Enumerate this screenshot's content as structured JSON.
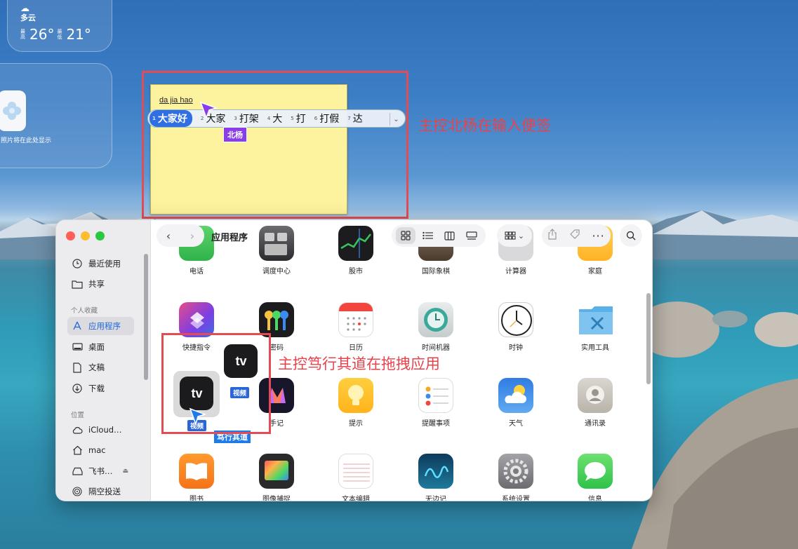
{
  "weather": {
    "condition": "多云",
    "high_label": "最高",
    "high": "26°",
    "low_label": "最低",
    "low": "21°"
  },
  "photo_widget": {
    "text": "照片将在此处显示"
  },
  "sticky": {
    "text": "da jia hao"
  },
  "ime": {
    "candidates": [
      {
        "n": "1",
        "text": "大家好"
      },
      {
        "n": "2",
        "text": "大家"
      },
      {
        "n": "3",
        "text": "打架"
      },
      {
        "n": "4",
        "text": "大"
      },
      {
        "n": "5",
        "text": "打"
      },
      {
        "n": "6",
        "text": "打假"
      },
      {
        "n": "7",
        "text": "达"
      }
    ]
  },
  "cursors": {
    "beiyang": "北杨",
    "duxing": "笃行其道"
  },
  "annotations": {
    "sticky_label": "主控北杨在输入便签",
    "drag_label": "主控笃行其道在拖拽应用"
  },
  "finder": {
    "title": "应用程序",
    "sidebar": {
      "recent": "最近使用",
      "shared": "共享",
      "favorites_header": "个人收藏",
      "applications": "应用程序",
      "desktop": "桌面",
      "documents": "文稿",
      "downloads": "下载",
      "locations_header": "位置",
      "icloud": "iCloud…",
      "mac": "mac",
      "feishu": "飞书…",
      "airdrop": "隔空投送"
    },
    "apps_row1": [
      "电话",
      "调度中心",
      "股市",
      "国际象棋",
      "计算器",
      "家庭"
    ],
    "apps_row2": [
      "快捷指令",
      "密码",
      "日历",
      "时间机器",
      "时钟",
      "实用工具"
    ],
    "apps_row3": [
      "视频",
      "手记",
      "提示",
      "提醒事项",
      "天气",
      "通讯录"
    ],
    "apps_row4": [
      "图书",
      "图像捕捉",
      "文本编辑",
      "无边记",
      "系统设置",
      "信息"
    ]
  },
  "drag": {
    "tv_text": "tv",
    "tag": "视频"
  },
  "colors": {
    "accent": "#1e66d8",
    "annotation": "#e34c55",
    "sticky": "#fdf39e",
    "cursor_purple": "#8a3ee8"
  }
}
